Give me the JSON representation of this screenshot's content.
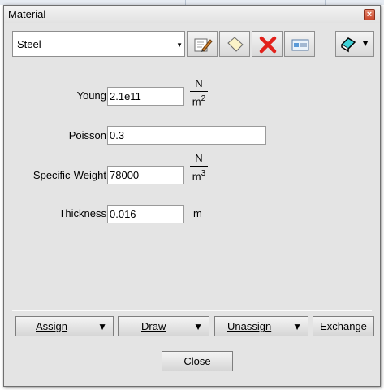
{
  "window": {
    "title": "Material"
  },
  "toolbar": {
    "material_selected": "Steel",
    "icons": [
      "edit-pencil-icon",
      "new-sheet-icon",
      "delete-icon",
      "window-icon",
      "eraser-icon"
    ]
  },
  "form": {
    "young": {
      "label": "Young",
      "value": "2.1e11",
      "unit_num": "N",
      "unit_den": "m",
      "unit_exp": "2"
    },
    "poisson": {
      "label": "Poisson",
      "value": "0.3"
    },
    "specific_weight": {
      "label": "Specific-Weight",
      "value": "78000",
      "unit_num": "N",
      "unit_den": "m",
      "unit_exp": "3"
    },
    "thickness": {
      "label": "Thickness",
      "value": "0.016",
      "unit": "m"
    }
  },
  "buttons": {
    "assign": "Assign",
    "draw": "Draw",
    "unassign": "Unassign",
    "exchange": "Exchange",
    "close": "Close"
  },
  "colors": {
    "close_red": "#c9472c",
    "window_bg": "#e4e4e4"
  }
}
